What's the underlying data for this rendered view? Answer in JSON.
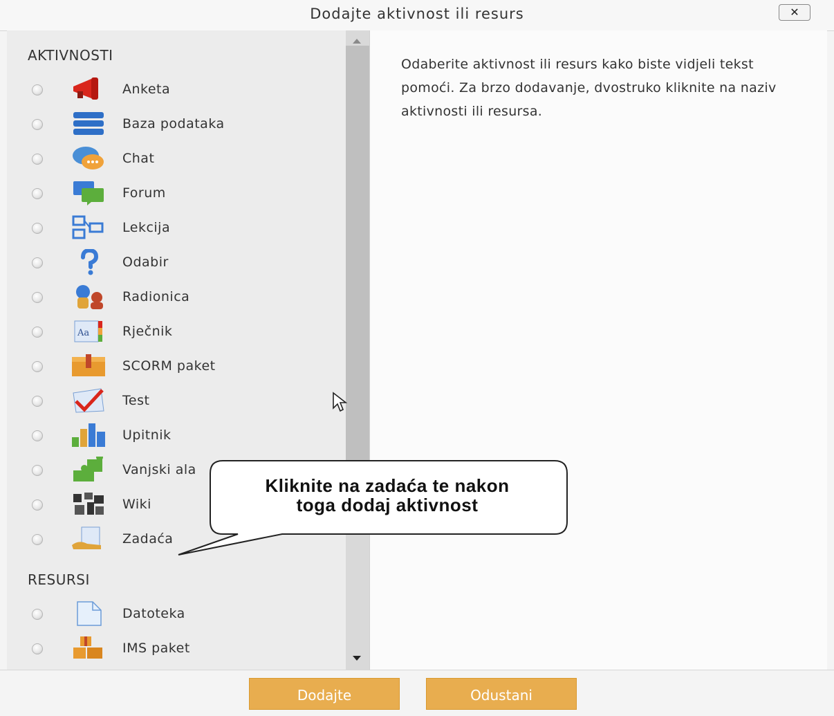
{
  "dialog": {
    "title": "Dodajte aktivnost ili resurs",
    "close_label": "✕"
  },
  "sections": {
    "activities_heading": "AKTIVNOSTI",
    "resources_heading": "RESURSI"
  },
  "activities": [
    {
      "label": "Anketa",
      "icon": "megaphone-icon"
    },
    {
      "label": "Baza podataka",
      "icon": "database-icon"
    },
    {
      "label": "Chat",
      "icon": "chat-bubble-icon"
    },
    {
      "label": "Forum",
      "icon": "forum-icon"
    },
    {
      "label": "Lekcija",
      "icon": "lesson-icon"
    },
    {
      "label": "Odabir",
      "icon": "question-icon"
    },
    {
      "label": "Radionica",
      "icon": "workshop-icon"
    },
    {
      "label": "Rječnik",
      "icon": "glossary-icon"
    },
    {
      "label": "SCORM paket",
      "icon": "package-icon"
    },
    {
      "label": "Test",
      "icon": "checkmark-icon"
    },
    {
      "label": "Upitnik",
      "icon": "bar-chart-icon"
    },
    {
      "label": "Vanjski ala",
      "icon": "puzzle-icon"
    },
    {
      "label": "Wiki",
      "icon": "wiki-icon"
    },
    {
      "label": "Zadaća",
      "icon": "assignment-icon"
    }
  ],
  "resources": [
    {
      "label": "Datoteka",
      "icon": "file-icon"
    },
    {
      "label": "IMS paket",
      "icon": "ims-package-icon"
    }
  ],
  "help_text": "Odaberite aktivnost ili resurs kako biste vidjeli tekst pomoći. Za brzo dodavanje, dvostruko kliknite na naziv aktivnosti ili resursa.",
  "buttons": {
    "add_label": "Dodajte",
    "cancel_label": "Odustani"
  },
  "callout": {
    "line1": "Kliknite na zadaća te nakon",
    "line2": "toga dodaj aktivnost"
  },
  "colors": {
    "button_bg": "#e8ad4f",
    "scrollbar_thumb": "#bfbfbf",
    "list_bg": "#ececec"
  }
}
